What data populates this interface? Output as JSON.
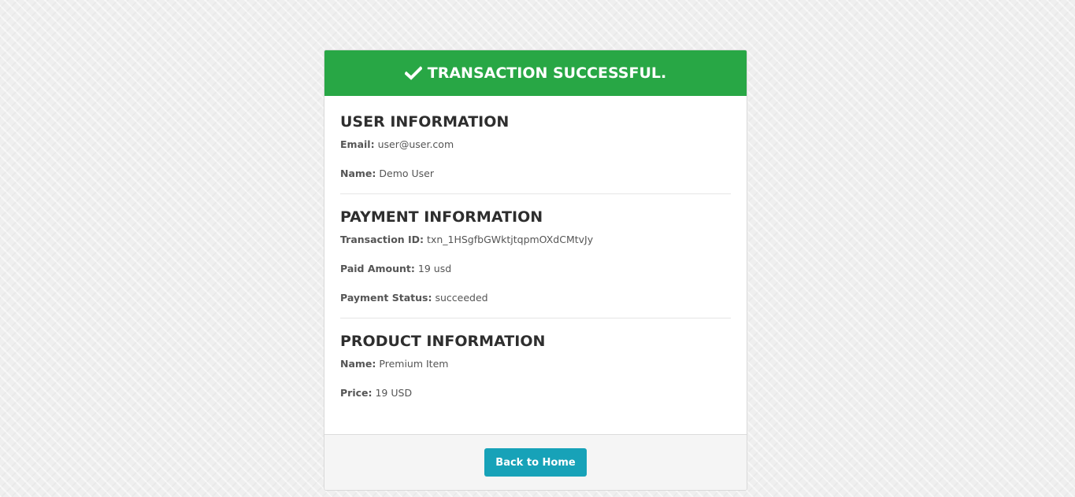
{
  "header": {
    "title": "TRANSACTION SUCCESSFUL.",
    "icon": "check-icon",
    "color": "#28a745"
  },
  "user_info": {
    "title": "USER INFORMATION",
    "email_label": "Email:",
    "email": "user@user.com",
    "name_label": "Name:",
    "name": "Demo User"
  },
  "payment_info": {
    "title": "PAYMENT INFORMATION",
    "txn_label": "Transaction ID:",
    "txn_id": "txn_1HSgfbGWktjtqpmOXdCMtvJy",
    "amount_label": "Paid Amount:",
    "amount": "19 usd",
    "status_label": "Payment Status:",
    "status": "succeeded"
  },
  "product_info": {
    "title": "PRODUCT INFORMATION",
    "name_label": "Name:",
    "name": "Premium Item",
    "price_label": "Price:",
    "price": "19 USD"
  },
  "footer": {
    "button_label": "Back to Home",
    "button_color": "#17a2b8"
  }
}
